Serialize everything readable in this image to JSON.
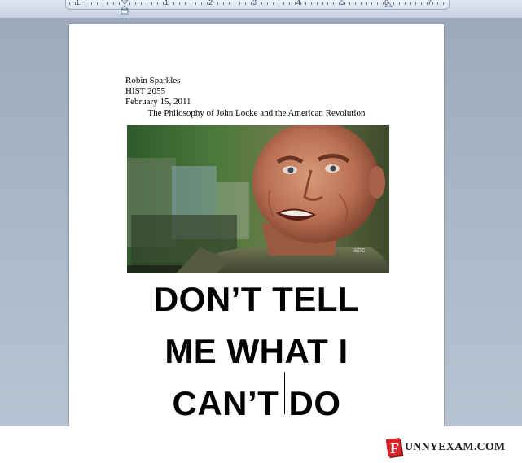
{
  "ruler": {
    "numbers": [
      "1",
      "1",
      "2",
      "3",
      "4",
      "5",
      "6",
      "7"
    ]
  },
  "document": {
    "header_lines": [
      "Robin Sparkles",
      "HIST 2055",
      "February 15, 2011"
    ],
    "title": "The Philosophy of John Locke and the American Revolution",
    "photo_watermark": "abc",
    "caption_lines": [
      "DON’T TELL",
      "ME WHAT I",
      "CAN’T DO"
    ]
  },
  "watermark": {
    "logo_letter": "F",
    "logo_text": "UNNYEXAM.COM"
  },
  "colors": {
    "workspace": "#a9b4c4",
    "ruler": "#d6e0ee",
    "logo_red": "#d8232a"
  }
}
